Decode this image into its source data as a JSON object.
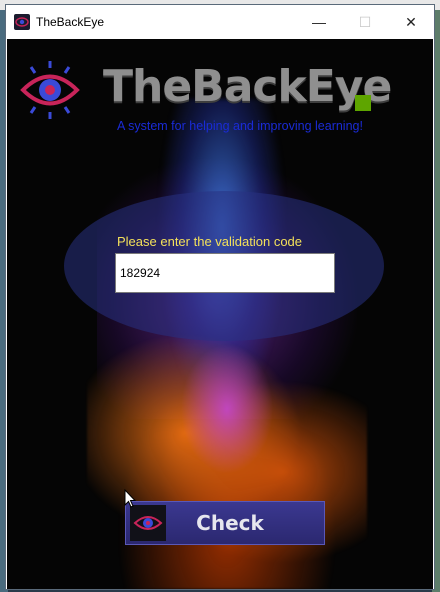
{
  "window": {
    "title": "TheBackEye",
    "minimize_glyph": "—",
    "maximize_glyph": "☐",
    "close_glyph": "✕"
  },
  "header": {
    "brand": "TheBackEye",
    "tagline": "A system for helping and improving learning!"
  },
  "form": {
    "prompt": "Please enter the validation code",
    "code_value": "182924"
  },
  "actions": {
    "check_label": "Check"
  },
  "icons": {
    "app": "eye-icon",
    "logo": "eye-logo-icon",
    "check": "eye-icon"
  },
  "colors": {
    "tagline": "#1a2bd6",
    "prompt": "#f3e05a",
    "brand": "#8f8f8f",
    "brand_accent": "#5ea500",
    "button": "#2f2c7c"
  }
}
